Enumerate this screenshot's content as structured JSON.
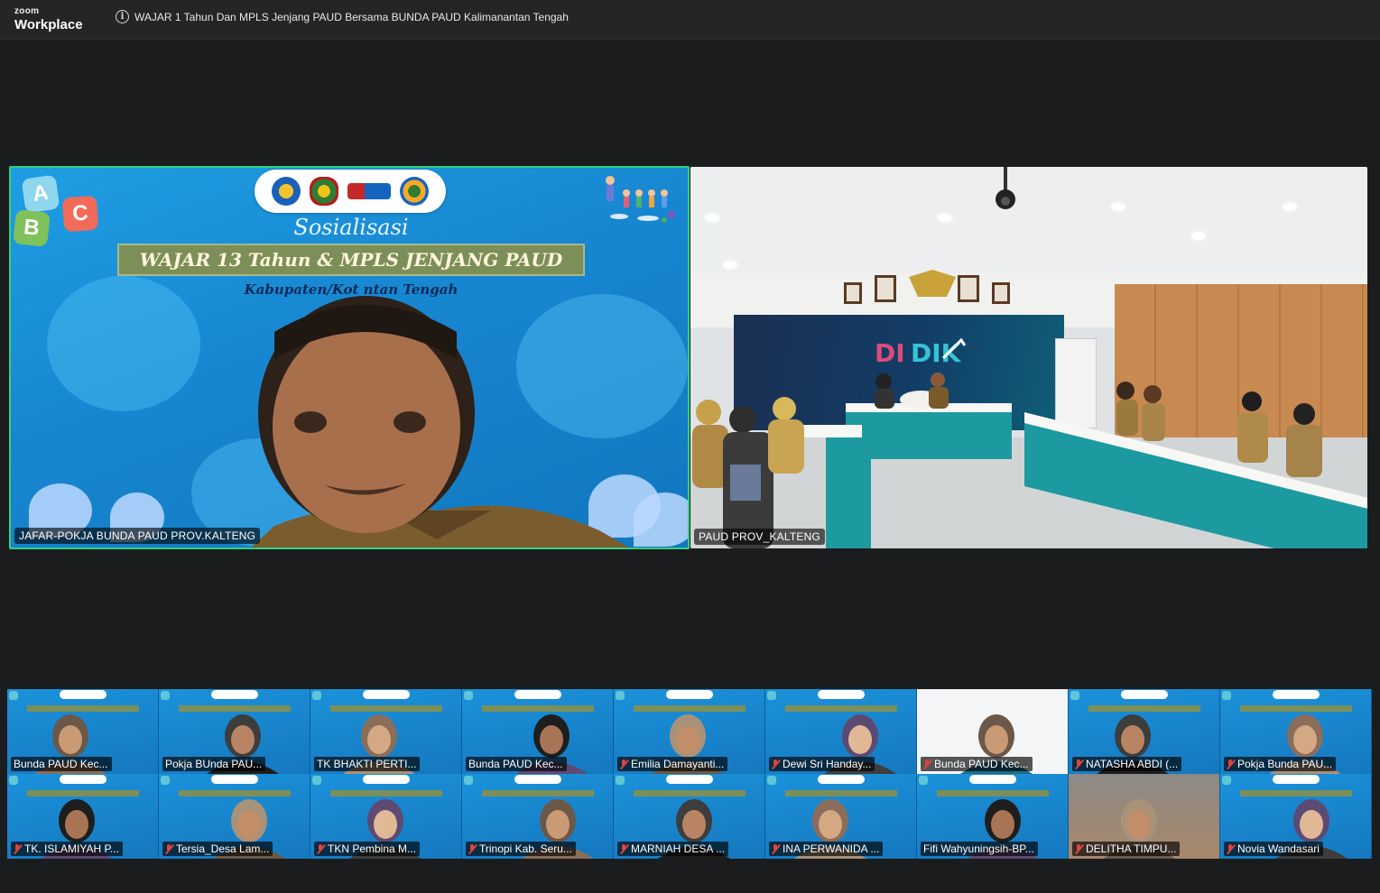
{
  "app": {
    "brand_top": "zoom",
    "brand_bottom": "Workplace",
    "meeting_title": "WAJAR  1 Tahun Dan MPLS Jenjang PAUD Bersama BUNDA PAUD Kalimanantan Tengah",
    "info_icon": "info-icon"
  },
  "speaker_video": {
    "name": "JAFAR-POKJA BUNDA PAUD PROV.KALTENG",
    "active_speaker": true,
    "slide": {
      "abc_letters": [
        "A",
        "B",
        "C"
      ],
      "heading": "Sosialisasi",
      "banner": "WAJAR 13 Tahun & MPLS JENJANG PAUD",
      "subheading": "Kabupaten/Kot                    ntan Tengah"
    }
  },
  "room_video": {
    "name": "PAUD PROV_KALTENG"
  },
  "gallery": {
    "tiles": [
      {
        "name": "Bunda PAUD Kec...",
        "muted": false,
        "bg": "slide"
      },
      {
        "name": "Pokja BUnda PAU...",
        "muted": false,
        "bg": "slide"
      },
      {
        "name": "TK BHAKTI PERTI...",
        "muted": false,
        "bg": "slide"
      },
      {
        "name": "Bunda PAUD Kec...",
        "muted": false,
        "bg": "slide"
      },
      {
        "name": "Emilia Damayanti...",
        "muted": true,
        "bg": "slide"
      },
      {
        "name": "Dewi Sri Handay...",
        "muted": true,
        "bg": "slide"
      },
      {
        "name": "Bunda PAUD Kec...",
        "muted": true,
        "bg": "white"
      },
      {
        "name": "NATASHA ABDI (...",
        "muted": true,
        "bg": "slide"
      },
      {
        "name": "Pokja Bunda PAU...",
        "muted": true,
        "bg": "slide"
      },
      {
        "name": "TK. ISLAMIYAH P...",
        "muted": true,
        "bg": "slide"
      },
      {
        "name": "Tersia_Desa Lam...",
        "muted": true,
        "bg": "slide"
      },
      {
        "name": "TKN Pembina M...",
        "muted": true,
        "bg": "slide"
      },
      {
        "name": "Trinopi Kab. Seru...",
        "muted": true,
        "bg": "slide"
      },
      {
        "name": "MARNIAH DESA ...",
        "muted": true,
        "bg": "slide"
      },
      {
        "name": "INA PERWANIDA ...",
        "muted": true,
        "bg": "slide"
      },
      {
        "name": "Fifi Wahyuningsih-BP...",
        "muted": false,
        "bg": "slide"
      },
      {
        "name": "DELITHA TIMPU...",
        "muted": true,
        "bg": "room"
      },
      {
        "name": "Novia Wandasari",
        "muted": true,
        "bg": "slide"
      }
    ]
  },
  "colors": {
    "active_border": "#33d17a",
    "mic_off": "#e0443b",
    "stage_bg": "#1a1c1e"
  }
}
